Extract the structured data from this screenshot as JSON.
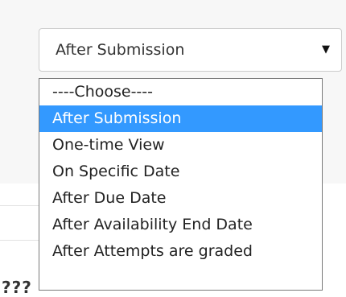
{
  "select": {
    "value": "After Submission",
    "arrow_icon": "caret-down-icon"
  },
  "options": [
    {
      "label": "----Choose----",
      "selected": false
    },
    {
      "label": "After Submission",
      "selected": true
    },
    {
      "label": "One-time View",
      "selected": false
    },
    {
      "label": "On Specific Date",
      "selected": false
    },
    {
      "label": "After Due Date",
      "selected": false
    },
    {
      "label": "After Availability End Date",
      "selected": false
    },
    {
      "label": "After Attempts are graded",
      "selected": false
    }
  ],
  "background_cutoff_text": "???",
  "colors": {
    "highlight": "#3399ff",
    "highlight_text": "#ffffff",
    "text": "#222222",
    "page_band": "#f7f7f7"
  }
}
